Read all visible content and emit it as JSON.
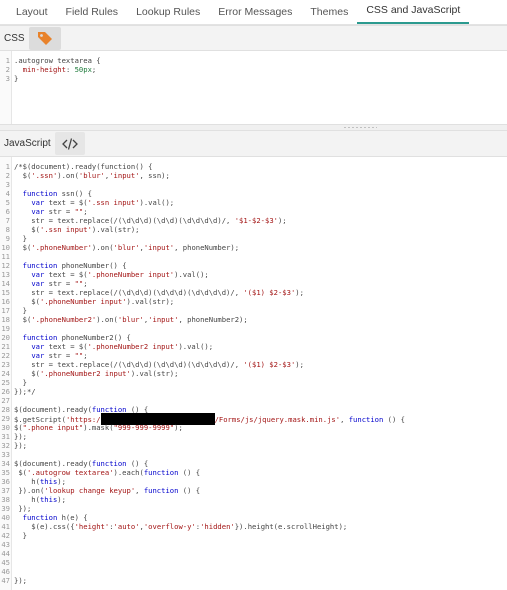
{
  "tabs": [
    {
      "label": "Layout",
      "active": false
    },
    {
      "label": "Field Rules",
      "active": false
    },
    {
      "label": "Lookup Rules",
      "active": false
    },
    {
      "label": "Error Messages",
      "active": false
    },
    {
      "label": "Themes",
      "active": false
    },
    {
      "label": "CSS and JavaScript",
      "active": true
    }
  ],
  "css_section": {
    "label": "CSS",
    "icon": "tag-icon",
    "icon_color": "#e8822a",
    "lines": [
      [
        {
          "t": ".autogrow textarea {"
        }
      ],
      [
        {
          "t": "  "
        },
        {
          "t": "min-height",
          "c": "css-prop"
        },
        {
          "t": ": "
        },
        {
          "t": "50px",
          "c": "css-val"
        },
        {
          "t": ";"
        }
      ],
      [
        {
          "t": "}"
        }
      ]
    ]
  },
  "js_section": {
    "label": "JavaScript",
    "icon": "code-icon",
    "lines": [
      [
        {
          "t": "/*$(document).ready(function() {"
        }
      ],
      [
        {
          "t": "  $("
        },
        {
          "t": "'.ssn'",
          "c": "js-str"
        },
        {
          "t": ").on("
        },
        {
          "t": "'blur'",
          "c": "js-str"
        },
        {
          "t": ","
        },
        {
          "t": "'input'",
          "c": "js-str"
        },
        {
          "t": ", ssn);"
        }
      ],
      [
        {
          "t": ""
        }
      ],
      [
        {
          "t": "  "
        },
        {
          "t": "function",
          "c": "js-kw"
        },
        {
          "t": " ssn() {"
        }
      ],
      [
        {
          "t": "    "
        },
        {
          "t": "var",
          "c": "js-kw"
        },
        {
          "t": " text = $("
        },
        {
          "t": "'.ssn input'",
          "c": "js-str"
        },
        {
          "t": ").val();"
        }
      ],
      [
        {
          "t": "    "
        },
        {
          "t": "var",
          "c": "js-kw"
        },
        {
          "t": " str = "
        },
        {
          "t": "\"\"",
          "c": "js-str"
        },
        {
          "t": ";"
        }
      ],
      [
        {
          "t": "    str = text.replace(/(\\d\\d\\d)(\\d\\d)(\\d\\d\\d\\d)/, "
        },
        {
          "t": "'$1-$2-$3'",
          "c": "js-str"
        },
        {
          "t": ");"
        }
      ],
      [
        {
          "t": "    $("
        },
        {
          "t": "'.ssn input'",
          "c": "js-str"
        },
        {
          "t": ").val(str);"
        }
      ],
      [
        {
          "t": "  }"
        }
      ],
      [
        {
          "t": "  $("
        },
        {
          "t": "'.phoneNumber'",
          "c": "js-str"
        },
        {
          "t": ").on("
        },
        {
          "t": "'blur'",
          "c": "js-str"
        },
        {
          "t": ","
        },
        {
          "t": "'input'",
          "c": "js-str"
        },
        {
          "t": ", phoneNumber);"
        }
      ],
      [
        {
          "t": ""
        }
      ],
      [
        {
          "t": "  "
        },
        {
          "t": "function",
          "c": "js-kw"
        },
        {
          "t": " phoneNumber() {"
        }
      ],
      [
        {
          "t": "    "
        },
        {
          "t": "var",
          "c": "js-kw"
        },
        {
          "t": " text = $("
        },
        {
          "t": "'.phoneNumber input'",
          "c": "js-str"
        },
        {
          "t": ").val();"
        }
      ],
      [
        {
          "t": "    "
        },
        {
          "t": "var",
          "c": "js-kw"
        },
        {
          "t": " str = "
        },
        {
          "t": "\"\"",
          "c": "js-str"
        },
        {
          "t": ";"
        }
      ],
      [
        {
          "t": "    str = text.replace(/(\\d\\d\\d)(\\d\\d\\d)(\\d\\d\\d\\d)/, "
        },
        {
          "t": "'($1) $2-$3'",
          "c": "js-str"
        },
        {
          "t": ");"
        }
      ],
      [
        {
          "t": "    $("
        },
        {
          "t": "'.phoneNumber input'",
          "c": "js-str"
        },
        {
          "t": ").val(str);"
        }
      ],
      [
        {
          "t": "  }"
        }
      ],
      [
        {
          "t": "  $("
        },
        {
          "t": "'.phoneNumber2'",
          "c": "js-str"
        },
        {
          "t": ").on("
        },
        {
          "t": "'blur'",
          "c": "js-str"
        },
        {
          "t": ","
        },
        {
          "t": "'input'",
          "c": "js-str"
        },
        {
          "t": ", phoneNumber2);"
        }
      ],
      [
        {
          "t": ""
        }
      ],
      [
        {
          "t": "  "
        },
        {
          "t": "function",
          "c": "js-kw"
        },
        {
          "t": " phoneNumber2() {"
        }
      ],
      [
        {
          "t": "    "
        },
        {
          "t": "var",
          "c": "js-kw"
        },
        {
          "t": " text = $("
        },
        {
          "t": "'.phoneNumber2 input'",
          "c": "js-str"
        },
        {
          "t": ").val();"
        }
      ],
      [
        {
          "t": "    "
        },
        {
          "t": "var",
          "c": "js-kw"
        },
        {
          "t": " str = "
        },
        {
          "t": "\"\"",
          "c": "js-str"
        },
        {
          "t": ";"
        }
      ],
      [
        {
          "t": "    str = text.replace(/(\\d\\d\\d)(\\d\\d\\d)(\\d\\d\\d\\d)/, "
        },
        {
          "t": "'($1) $2-$3'",
          "c": "js-str"
        },
        {
          "t": ");"
        }
      ],
      [
        {
          "t": "    $("
        },
        {
          "t": "'.phoneNumber2 input'",
          "c": "js-str"
        },
        {
          "t": ").val(str);"
        }
      ],
      [
        {
          "t": "  }"
        }
      ],
      [
        {
          "t": "});*/"
        }
      ],
      [
        {
          "t": ""
        }
      ],
      [
        {
          "t": "$(document).ready("
        },
        {
          "t": "function",
          "c": "js-kw"
        },
        {
          "t": " () {"
        }
      ],
      [
        {
          "t": "$.getScript("
        },
        {
          "t": "'https:/",
          "c": "js-str"
        },
        {
          "t": "",
          "redact": true
        },
        {
          "t": "/Forms/js/jquery.mask.min.js'",
          "c": "js-str"
        },
        {
          "t": ", "
        },
        {
          "t": "function",
          "c": "js-kw"
        },
        {
          "t": " () {"
        }
      ],
      [
        {
          "t": "$("
        },
        {
          "t": "\".phone input\"",
          "c": "js-str"
        },
        {
          "t": ").mask("
        },
        {
          "t": "\"999-999-9999\"",
          "c": "js-str"
        },
        {
          "t": ");"
        }
      ],
      [
        {
          "t": "});"
        }
      ],
      [
        {
          "t": "});"
        }
      ],
      [
        {
          "t": ""
        }
      ],
      [
        {
          "t": "$(document).ready("
        },
        {
          "t": "function",
          "c": "js-kw"
        },
        {
          "t": " () {"
        }
      ],
      [
        {
          "t": " $("
        },
        {
          "t": "'.autogrow textarea'",
          "c": "js-str"
        },
        {
          "t": ").each("
        },
        {
          "t": "function",
          "c": "js-kw"
        },
        {
          "t": " () {"
        }
      ],
      [
        {
          "t": "    h("
        },
        {
          "t": "this",
          "c": "js-kw"
        },
        {
          "t": ");"
        }
      ],
      [
        {
          "t": " }).on("
        },
        {
          "t": "'lookup change keyup'",
          "c": "js-str"
        },
        {
          "t": ", "
        },
        {
          "t": "function",
          "c": "js-kw"
        },
        {
          "t": " () {"
        }
      ],
      [
        {
          "t": "    h("
        },
        {
          "t": "this",
          "c": "js-kw"
        },
        {
          "t": ");"
        }
      ],
      [
        {
          "t": " });"
        }
      ],
      [
        {
          "t": "  "
        },
        {
          "t": "function",
          "c": "js-kw"
        },
        {
          "t": " h(e) {"
        }
      ],
      [
        {
          "t": "    $(e).css({"
        },
        {
          "t": "'height'",
          "c": "js-str"
        },
        {
          "t": ":"
        },
        {
          "t": "'auto'",
          "c": "js-str"
        },
        {
          "t": ","
        },
        {
          "t": "'overflow-y'",
          "c": "js-str"
        },
        {
          "t": ":"
        },
        {
          "t": "'hidden'",
          "c": "js-str"
        },
        {
          "t": "}).height(e.scrollHeight);"
        }
      ],
      [
        {
          "t": "  }"
        }
      ],
      [
        {
          "t": ""
        }
      ],
      [
        {
          "t": ""
        }
      ],
      [
        {
          "t": ""
        }
      ],
      [
        {
          "t": ""
        }
      ],
      [
        {
          "t": "});"
        }
      ]
    ]
  }
}
